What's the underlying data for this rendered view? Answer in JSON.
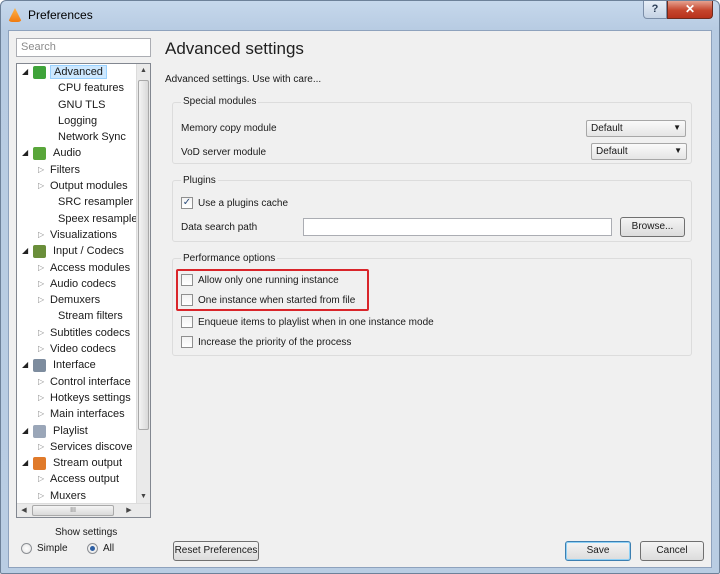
{
  "window": {
    "title": "Preferences",
    "help_label": "?",
    "close_label": "✕"
  },
  "sidebar": {
    "search_placeholder": "Search",
    "tree": [
      {
        "label": "Advanced",
        "level": 0,
        "expanded": true,
        "selected": true,
        "icon": "settings-icon",
        "color": "#3fa33a"
      },
      {
        "label": "CPU features",
        "level": 1,
        "leaf": true
      },
      {
        "label": "GNU TLS",
        "level": 1,
        "leaf": true
      },
      {
        "label": "Logging",
        "level": 1,
        "leaf": true
      },
      {
        "label": "Network Sync",
        "level": 1,
        "leaf": true
      },
      {
        "label": "Audio",
        "level": 0,
        "expanded": true,
        "icon": "music-note-icon",
        "color": "#59a63a"
      },
      {
        "label": "Filters",
        "level": 1
      },
      {
        "label": "Output modules",
        "level": 1
      },
      {
        "label": "SRC resampler",
        "level": 1,
        "leaf": true
      },
      {
        "label": "Speex resampler",
        "level": 1,
        "leaf": true
      },
      {
        "label": "Visualizations",
        "level": 1
      },
      {
        "label": "Input / Codecs",
        "level": 0,
        "expanded": true,
        "icon": "codec-icon",
        "color": "#6a8e3a"
      },
      {
        "label": "Access modules",
        "level": 1
      },
      {
        "label": "Audio codecs",
        "level": 1
      },
      {
        "label": "Demuxers",
        "level": 1
      },
      {
        "label": "Stream filters",
        "level": 1,
        "leaf": true
      },
      {
        "label": "Subtitles codecs",
        "level": 1
      },
      {
        "label": "Video codecs",
        "level": 1
      },
      {
        "label": "Interface",
        "level": 0,
        "expanded": true,
        "icon": "interface-icon",
        "color": "#7d8c9e"
      },
      {
        "label": "Control interface",
        "level": 1
      },
      {
        "label": "Hotkeys settings",
        "level": 1
      },
      {
        "label": "Main interfaces",
        "level": 1
      },
      {
        "label": "Playlist",
        "level": 0,
        "expanded": true,
        "icon": "playlist-icon",
        "color": "#9aa6b8"
      },
      {
        "label": "Services discove",
        "level": 1
      },
      {
        "label": "Stream output",
        "level": 0,
        "expanded": true,
        "icon": "stream-output-icon",
        "color": "#e07a2a"
      },
      {
        "label": "Access output",
        "level": 1
      },
      {
        "label": "Muxers",
        "level": 1
      }
    ],
    "hscroll_grip": "III",
    "show_settings_label": "Show settings",
    "simple_label": "Simple",
    "all_label": "All",
    "selected_mode": "All"
  },
  "main": {
    "title": "Advanced settings",
    "subtitle": "Advanced settings. Use with care...",
    "special_modules": {
      "title": "Special modules",
      "memory_copy_label": "Memory copy module",
      "memory_copy_value": "Default",
      "vod_label": "VoD server module",
      "vod_value": "Default"
    },
    "plugins": {
      "title": "Plugins",
      "use_cache_label": "Use a plugins cache",
      "use_cache_checked": true,
      "search_path_label": "Data search path",
      "search_path_value": "",
      "browse_label": "Browse..."
    },
    "performance": {
      "title": "Performance options",
      "options": [
        {
          "label": "Allow only one running instance",
          "checked": false
        },
        {
          "label": "One instance when started from file",
          "checked": false
        },
        {
          "label": "Enqueue items to playlist when in one instance mode",
          "checked": false
        },
        {
          "label": "Increase the priority of the process",
          "checked": false
        }
      ]
    }
  },
  "footer": {
    "reset_label": "Reset Preferences",
    "save_label": "Save",
    "cancel_label": "Cancel"
  },
  "colors": {
    "highlight": "#d9252a",
    "selection": "#cde8ff"
  }
}
